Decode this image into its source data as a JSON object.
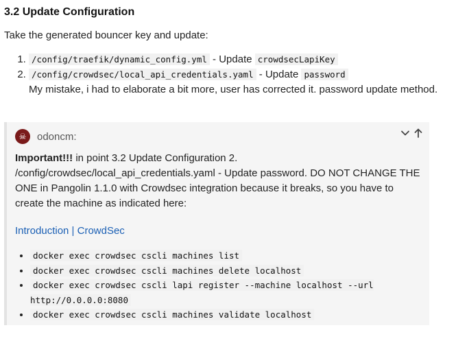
{
  "section": {
    "title": "3.2 Update Configuration",
    "intro": "Take the generated bouncer key and update:"
  },
  "steps": [
    {
      "path": "/config/traefik/dynamic_config.yml",
      "sep": " - Update ",
      "key": "crowdsecLapiKey"
    },
    {
      "path": "/config/crowdsec/local_api_credentials.yaml",
      "sep": " - Update ",
      "key": "password",
      "note": "My mistake, i had to elaborate a bit more, user has corrected it. password update method."
    }
  ],
  "quote": {
    "username": "odoncm:",
    "avatar_icon": "pirate-skull-icon",
    "collapse_icon": "chevron-down-icon",
    "jump_icon": "arrow-up-icon",
    "important_label": "Important!!!",
    "body_text": "in point 3.2 Update Configuration 2. /config/crowdsec/local_api_credentials.yaml - Update password. DO NOT CHANGE THE ONE in Pangolin 1.1.0 with Crowdsec integration because it breaks, so you have to create the machine as indicated here:",
    "link_text": "Introduction | CrowdSec",
    "commands": [
      "docker exec crowdsec cscli machines list",
      "docker exec crowdsec cscli machines delete localhost",
      "docker exec crowdsec cscli lapi register --machine localhost --url http://0.0.0.0:8080",
      "docker exec crowdsec cscli machines validate localhost"
    ]
  },
  "colors": {
    "link": "#1a5fb4",
    "quote_bg": "#f5f5f5",
    "quote_border": "#e3e3e3",
    "code_bg": "#f1f1f1"
  }
}
